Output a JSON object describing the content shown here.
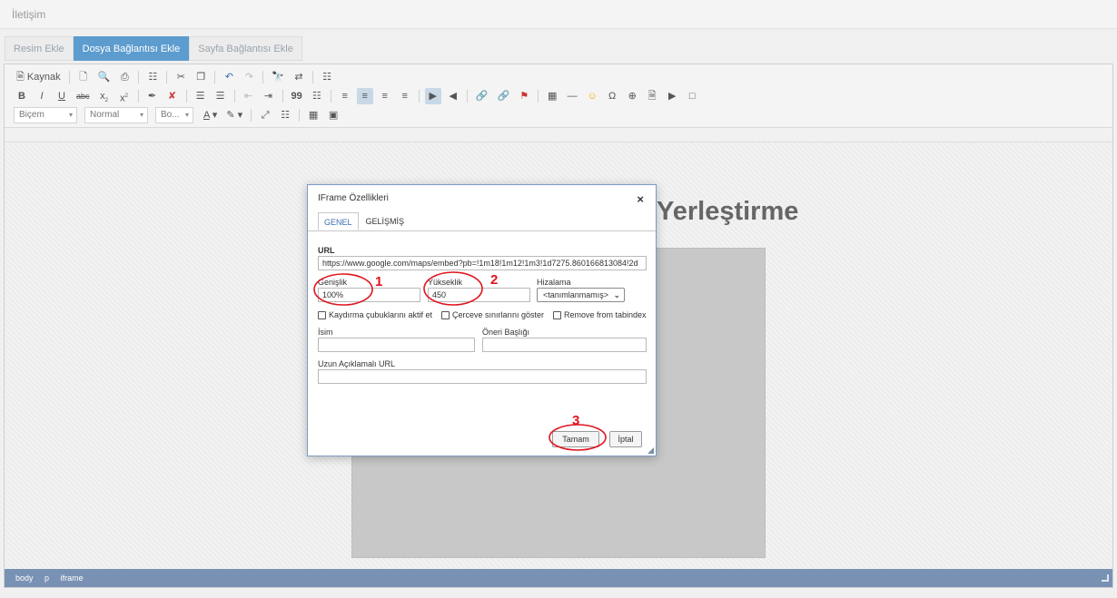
{
  "page": {
    "title": "İletişim"
  },
  "tabs": [
    {
      "label": "Resim Ekle",
      "active": false
    },
    {
      "label": "Dosya Bağlantısı Ekle",
      "active": true
    },
    {
      "label": "Sayfa Bağlantısı Ekle",
      "active": false
    }
  ],
  "toolbar": {
    "source_label": "Kaynak",
    "bold": "B",
    "italic": "I",
    "underline": "U",
    "strike": "abc",
    "subscript": "x",
    "superscript": "x",
    "quote": "99",
    "format_label": "Biçem",
    "style_label": "Normal",
    "font_label": "Bo...",
    "text_color": "A"
  },
  "editor": {
    "heading": "Yerleştirme",
    "path": [
      "body",
      "p",
      "iframe"
    ]
  },
  "dialog": {
    "title": "IFrame Özellikleri",
    "close": "×",
    "tabs": [
      {
        "label": "GENEL",
        "active": true
      },
      {
        "label": "GELİŞMİŞ",
        "active": false
      }
    ],
    "url_label": "URL",
    "url_value": "https://www.google.com/maps/embed?pb=!1m18!1m12!1m3!1d7275.860166813084!2d",
    "width_label": "Genişlik",
    "width_value": "100%",
    "height_label": "Yükseklik",
    "height_value": "450",
    "align_label": "Hizalama",
    "align_value": "<tanımlanmamış>",
    "checkboxes": [
      "Kaydırma çubuklarını aktif et",
      "Çerceve sınırlarını göster",
      "Remove from tabindex"
    ],
    "name_label": "İsim",
    "title_label": "Öneri Başlığı",
    "longdesc_label": "Uzun Açıklamalı URL",
    "ok_label": "Tamam",
    "cancel_label": "İptal"
  },
  "annotations": {
    "one": "1",
    "two": "2",
    "three": "3",
    "color": "#e0141e"
  }
}
